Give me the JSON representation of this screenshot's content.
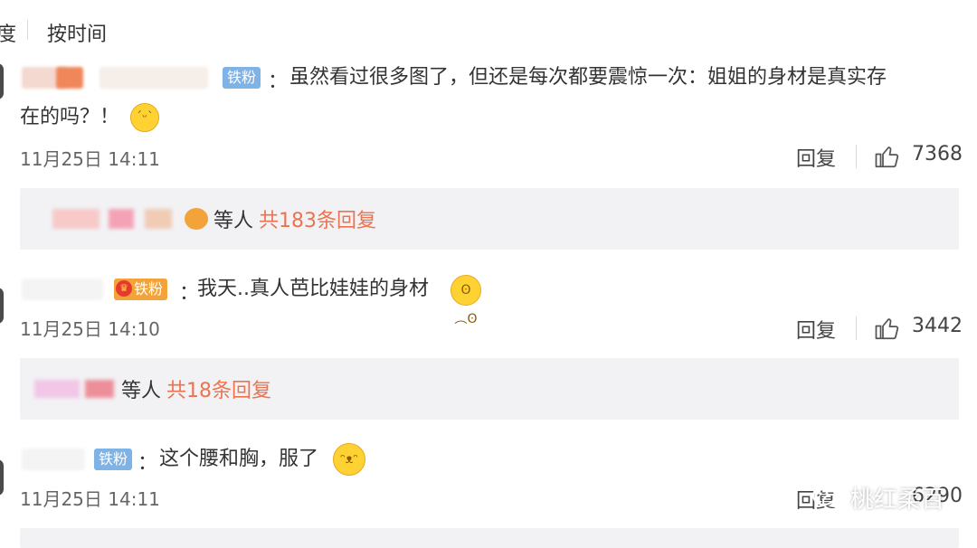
{
  "sort_bar": {
    "partial_label": "度",
    "time_label": "按时间"
  },
  "comments": [
    {
      "badge": "铁粉",
      "colon": "：",
      "text_line1": "虽然看过很多图了，但还是每次都要震惊一次：姐姐的身材是真实存",
      "text_line2": "在的吗？！",
      "emoji": "sweat-smile-emoji",
      "time": "11月25日 14:11",
      "reply_label": "回复",
      "likes": "7368",
      "replies_others": "等人",
      "replies_count": "共183条回复"
    },
    {
      "badge": "铁粉",
      "colon": "：",
      "text_line1": "我天..真人芭比娃娃的身材",
      "emoji": "pleading-face-emoji",
      "time": "11月25日 14:10",
      "reply_label": "回复",
      "likes": "3442",
      "replies_others": "等人",
      "replies_count": "共18条回复"
    },
    {
      "badge": "铁粉",
      "colon": "：",
      "text_line1": "这个腰和胸，服了",
      "emoji": "hugging-face-emoji",
      "time": "11月25日 14:11",
      "reply_label": "回复",
      "likes": "6290"
    }
  ],
  "watermark": "桃红柔百",
  "colors": {
    "accent_orange": "#eb7350",
    "badge_blue": "#7fb2e5",
    "badge_gold": "#f2a33a",
    "reply_bg": "#f2f2f5"
  }
}
